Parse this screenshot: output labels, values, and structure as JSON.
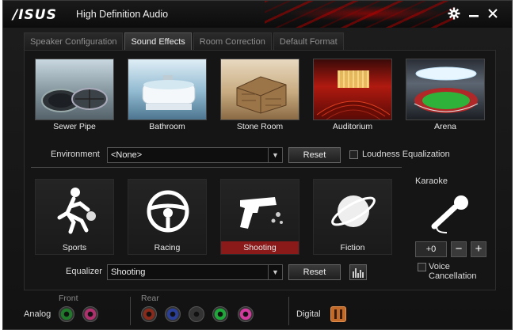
{
  "window": {
    "brand": "/ISUS",
    "title": "High Definition Audio"
  },
  "tabs": [
    {
      "label": "Speaker Configuration",
      "active": false
    },
    {
      "label": "Sound Effects",
      "active": true
    },
    {
      "label": "Room Correction",
      "active": false
    },
    {
      "label": "Default Format",
      "active": false
    }
  ],
  "environments": [
    {
      "label": "Sewer Pipe",
      "icon": "sewer-pipe-image"
    },
    {
      "label": "Bathroom",
      "icon": "bathroom-image"
    },
    {
      "label": "Stone Room",
      "icon": "stone-room-image"
    },
    {
      "label": "Auditorium",
      "icon": "auditorium-image"
    },
    {
      "label": "Arena",
      "icon": "arena-image"
    }
  ],
  "environment_row": {
    "label": "Environment",
    "value": "<None>",
    "reset_label": "Reset",
    "loudness_label": "Loudness Equalization",
    "loudness_checked": false
  },
  "presets": [
    {
      "label": "Sports",
      "icon": "sports-icon",
      "selected": false
    },
    {
      "label": "Racing",
      "icon": "steering-wheel-icon",
      "selected": false
    },
    {
      "label": "Shooting",
      "icon": "pistol-icon",
      "selected": true
    },
    {
      "label": "Fiction",
      "icon": "planet-icon",
      "selected": false
    }
  ],
  "equalizer_row": {
    "label": "Equalizer",
    "value": "Shooting",
    "reset_label": "Reset"
  },
  "karaoke": {
    "title": "Karaoke",
    "value": "+0",
    "minus": "−",
    "plus": "+",
    "voice_cancel_label": "Voice Cancellation",
    "voice_cancel_checked": false
  },
  "bottom": {
    "analog_label": "Analog",
    "front_label": "Front",
    "rear_label": "Rear",
    "digital_label": "Digital",
    "front_jacks": [
      "#1f7a2a",
      "#b0306e"
    ],
    "rear_jacks": [
      "#8a2a1a",
      "#2a3f9a",
      "#333333",
      "#1fa83a",
      "#d23a9e"
    ]
  },
  "colors": {
    "accent": "#8a1a1a"
  }
}
